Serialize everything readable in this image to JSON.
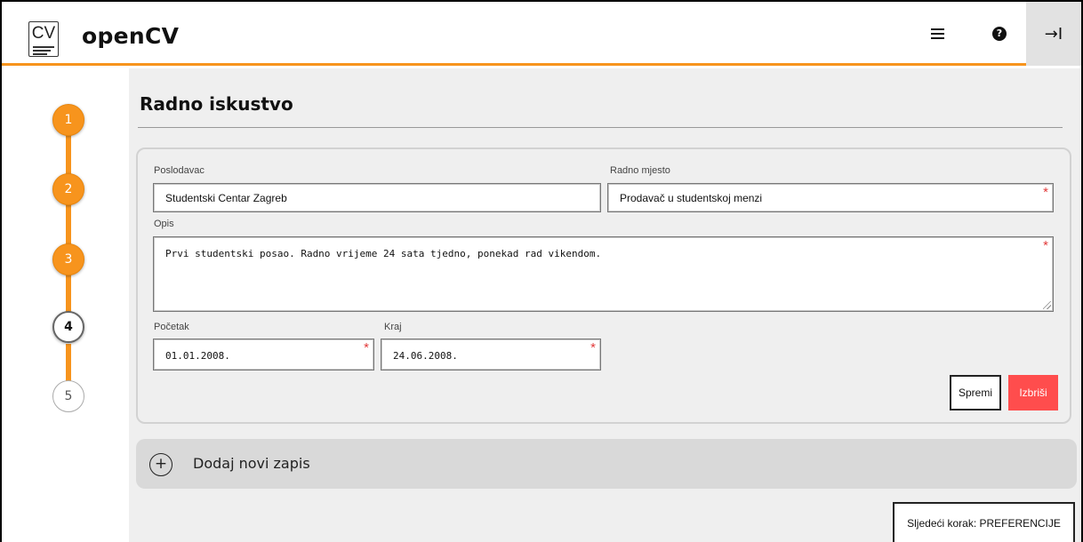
{
  "header": {
    "logo_text": "CV",
    "app_title": "openCV",
    "menu_icon": "hamburger-menu-icon",
    "help_icon": "question-circle-icon",
    "help_glyph": "?",
    "exit_icon": "arrow-right-to-bar-icon",
    "exit_glyph": "→I"
  },
  "steps": [
    {
      "label": "1",
      "state": "done"
    },
    {
      "label": "2",
      "state": "done"
    },
    {
      "label": "3",
      "state": "done"
    },
    {
      "label": "4",
      "state": "active"
    },
    {
      "label": "5",
      "state": "todo"
    }
  ],
  "colors": {
    "accent": "#f7941d",
    "delete": "#ff4d4d",
    "required": "#e23b3b"
  },
  "page": {
    "title": "Radno iskustvo"
  },
  "entry": {
    "employer_label": "Poslodavac",
    "employer_value": "Studentski Centar Zagreb",
    "position_label": "Radno mjesto",
    "position_value": "Prodavač u studentskoj menzi",
    "description_label": "Opis",
    "description_value": "Prvi studentski posao. Radno vrijeme 24 sata tjedno, ponekad rad vikendom.",
    "start_label": "Početak",
    "start_value": "01.01.2008.",
    "end_label": "Kraj",
    "end_value": "24.06.2008.",
    "required_mark": "*",
    "save_label": "Spremi",
    "delete_label": "Izbriši"
  },
  "add_entry": {
    "icon_glyph": "+",
    "label": "Dodaj novi zapis"
  },
  "next_step": {
    "label": "Sljedeći korak: PREFERENCIJE"
  }
}
